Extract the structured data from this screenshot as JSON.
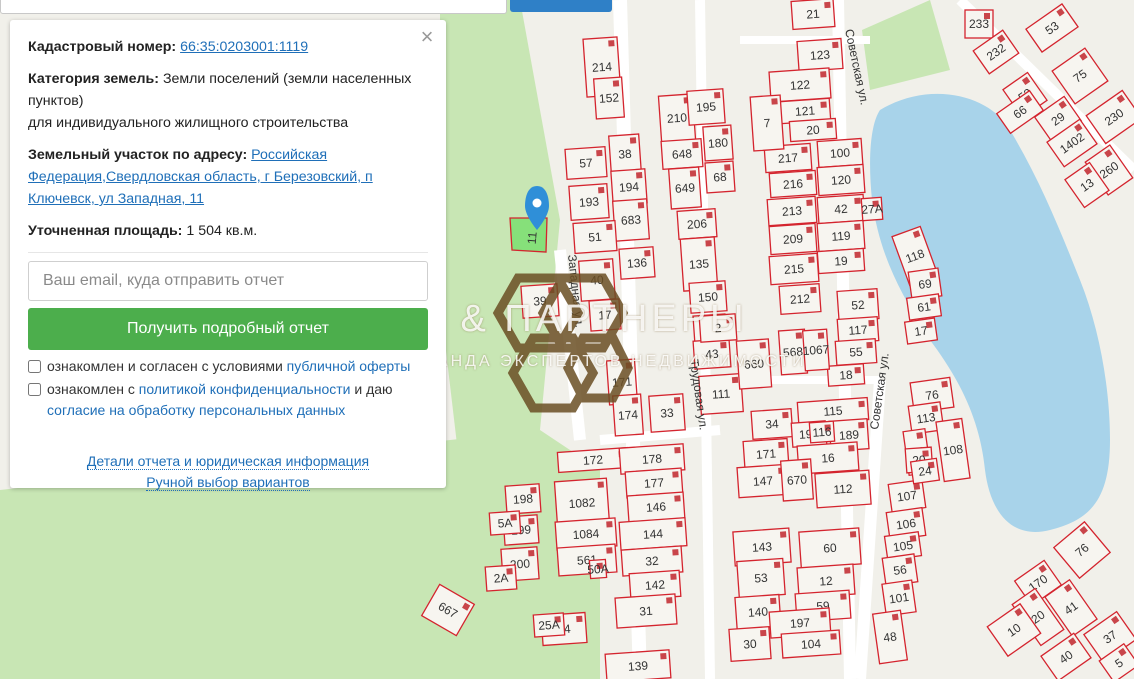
{
  "panel": {
    "cadastral_label": "Кадастровый номер:",
    "cadastral_value": "66:35:0203001:1119",
    "category_label": "Категория земель:",
    "category_value_1": "Земли поселений (земли населенных пунктов)",
    "category_value_2": "для индивидуального жилищного строительства",
    "address_label": "Земельный участок по адресу:",
    "address_value": "Российская Федерация,Свердловская область, г Березовский, п Ключевск, ул Западная, 11",
    "area_label": "Уточненная площадь:",
    "area_value": "1 504 кв.м.",
    "email_placeholder": "Ваш email, куда отправить отчет",
    "report_button": "Получить подробный отчет",
    "consent_1_prefix": "ознакомлен и согласен с условиями",
    "consent_1_link": "публичной оферты",
    "consent_2_prefix": "ознакомлен с",
    "consent_2_link": "политикой конфиденциальности",
    "consent_2_middle": "и даю",
    "consent_2_link2": "согласие на обработку персональных данных",
    "details_link": "Детали отчета и юридическая информация",
    "manual_link": "Ручной выбор вариантов",
    "close_icon": "close-icon"
  },
  "watermark": {
    "title": "КАЛАЧ & ПАРТНЕРЫ",
    "subtitle": "КОМАНДА ЭКСПЕРТОВ НЕДВИЖИМОСТИ"
  },
  "map": {
    "colors": {
      "plot_border": "#d4242e",
      "water": "#a8d3ea",
      "green": "#c8e6b4",
      "highlight": "#86e07a",
      "marker": "#2f8fd8"
    },
    "marker_icon": "map-pin-icon",
    "streets": [
      "Советская ул.",
      "Советская ул.",
      "Советская ул.",
      "Западная ул.",
      "Трудовая ул."
    ],
    "plots": [
      "21",
      "123",
      "122",
      "121",
      "20",
      "100",
      "217",
      "216",
      "120",
      "213",
      "42",
      "209",
      "119",
      "215",
      "19",
      "212",
      "52",
      "117",
      "55",
      "18",
      "214",
      "152",
      "210",
      "195",
      "648",
      "180",
      "649",
      "68",
      "206",
      "57",
      "38",
      "194",
      "193",
      "683",
      "51",
      "136",
      "135",
      "150",
      "111",
      "45",
      "43",
      "2",
      "40",
      "39",
      "17",
      "171",
      "174",
      "33",
      "115",
      "34",
      "190",
      "189",
      "171",
      "16",
      "147",
      "670",
      "112",
      "172",
      "178",
      "177",
      "1082",
      "146",
      "1084",
      "144",
      "561",
      "32",
      "142",
      "31",
      "198",
      "199",
      "200",
      "667",
      "64",
      "139",
      "143",
      "60",
      "53",
      "12",
      "140",
      "59",
      "197",
      "104",
      "30",
      "107",
      "106",
      "105",
      "56",
      "101",
      "48",
      "118",
      "69",
      "61",
      "17",
      "76",
      "113",
      "108",
      "15",
      "233",
      "53",
      "232",
      "75",
      "52",
      "66",
      "29",
      "230",
      "1402",
      "260",
      "13",
      "76",
      "170",
      "20",
      "41",
      "10",
      "40",
      "37",
      "5",
      "7",
      "568",
      "660",
      "1067",
      "116",
      "20",
      "24",
      "2A",
      "5A",
      "25A",
      "27A",
      "50A",
      "60",
      "1"
    ]
  }
}
